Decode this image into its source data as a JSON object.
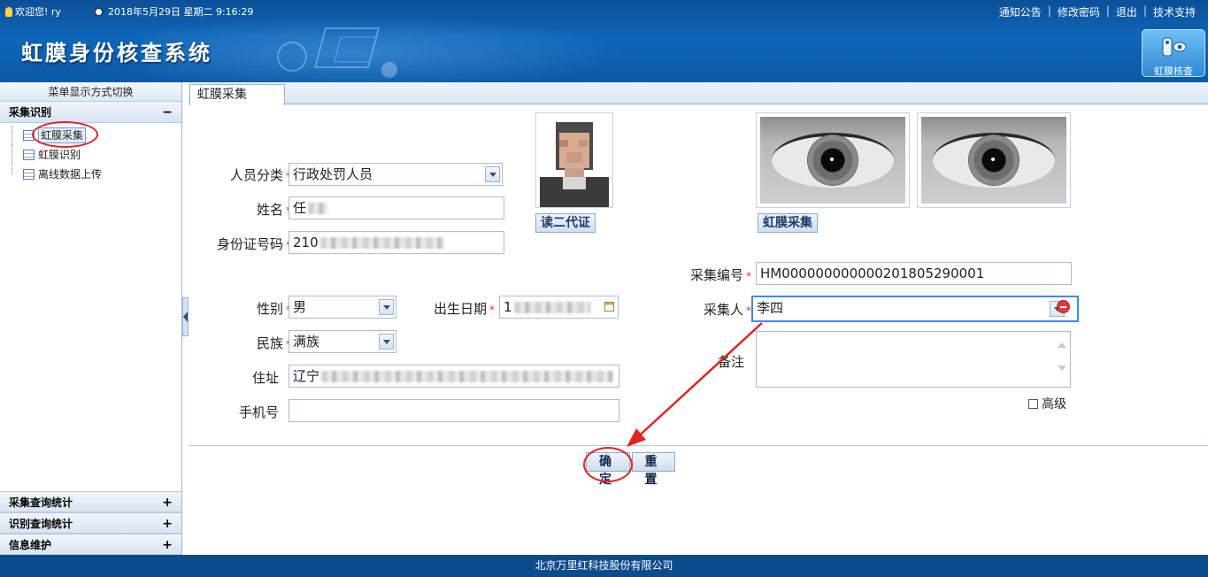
{
  "header": {
    "welcome": "欢迎您! ry",
    "datetime": "2018年5月29日 星期二 9:16:29",
    "links": [
      "通知公告",
      "修改密码",
      "退出",
      "技术支持"
    ],
    "system_title": "虹膜身份核查系统",
    "iris_check_button": "虹膜核查"
  },
  "sidebar": {
    "switch_label": "菜单显示方式切换",
    "groups": [
      {
        "label": "采集识别",
        "sign": "−",
        "items": [
          "虹膜采集",
          "虹膜识别",
          "离线数据上传"
        ]
      },
      {
        "label": "采集查询统计",
        "sign": "+"
      },
      {
        "label": "识别查询统计",
        "sign": "+"
      },
      {
        "label": "信息维护",
        "sign": "+"
      }
    ]
  },
  "main": {
    "tab": "虹膜采集",
    "form": {
      "category_label": "人员分类",
      "category_value": "行政处罚人员",
      "name_label": "姓名",
      "name_value": "任",
      "id_label": "身份证号码",
      "id_value": "210",
      "gender_label": "性别",
      "gender_value": "男",
      "birth_label": "出生日期",
      "birth_value": "1",
      "ethnicity_label": "民族",
      "ethnicity_value": "满族",
      "address_label": "住址",
      "address_value": "辽宁",
      "phone_label": "手机号",
      "phone_value": "",
      "collect_no_label": "采集编号",
      "collect_no_value": "HM000000000000201805290001",
      "collector_label": "采集人",
      "collector_value": "李四",
      "remark_label": "备注",
      "advanced_label": "高级"
    },
    "read_id_button": "读二代证",
    "iris_collect_button": "虹膜采集",
    "confirm_button": "确 定",
    "reset_button": "重 置"
  },
  "footer": {
    "company": "北京万里红科技股份有限公司"
  },
  "colors": {
    "header_blue": "#0e66b8",
    "annotation_red": "#e02424",
    "highlight_border": "#3a8ee6"
  }
}
